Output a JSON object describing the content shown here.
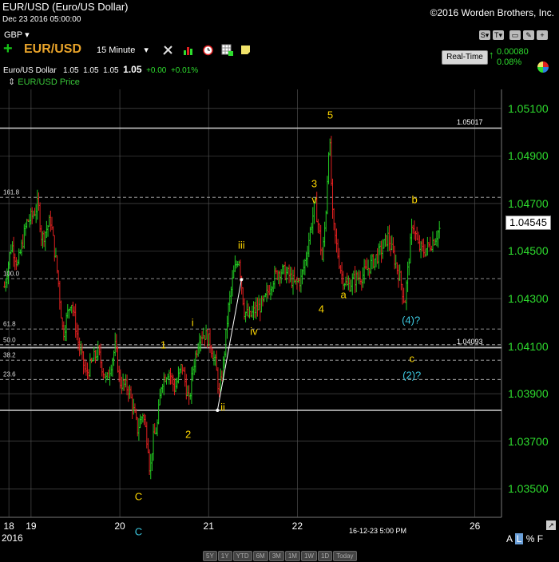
{
  "header": {
    "title": "EUR/USD (Euro/US Dollar)",
    "date": "Dec 23 2016 05:00:00",
    "copyright": "©2016 Worden Brothers, Inc.",
    "currency": "GBP ▾",
    "symbol": "EUR/USD",
    "interval": "15 Minute",
    "interval_arrow": "▾"
  },
  "quote": {
    "name": "Euro/US Dollar",
    "open": "1.05",
    "high": "1.05",
    "low": "1.05",
    "last": "1.05",
    "change": "+0.00",
    "change_pct": "+0.01%"
  },
  "legend": {
    "label": "EUR/USD Price",
    "arrow": "⇕"
  },
  "realtime": {
    "button": "Real-Time",
    "change": "0.00080",
    "change_pct": "0.08%"
  },
  "window_controls": [
    "S▾",
    "T▾",
    "▭",
    "✎",
    "+"
  ],
  "icons": [
    "tools-icon",
    "bar-chart-icon",
    "alarm-clock-icon",
    "grid-add-icon",
    "note-icon"
  ],
  "last_price_label": "1.04545",
  "bottom": {
    "year": "2016",
    "stamp": "16-12-23 5:00 PM",
    "zoom": [
      "5Y",
      "1Y",
      "YTD",
      "6M",
      "3M",
      "1M",
      "1W",
      "1D",
      "Today"
    ],
    "scale": {
      "a": "A",
      "l": "L",
      "pct": "%",
      "f": "F"
    },
    "scroll": "↗"
  },
  "chart_data": {
    "type": "line",
    "style": "ohlc-bars",
    "colors": {
      "up": "#22cc22",
      "down": "#e02020",
      "grid": "#5a5a5a",
      "axis_text": "#2edc2e"
    },
    "ylim": [
      1.0338,
      1.0518
    ],
    "yticks": [
      "1.03500",
      "1.03700",
      "1.03900",
      "1.04100",
      "1.04300",
      "1.04500",
      "1.04700",
      "1.04900",
      "1.05100"
    ],
    "xticks": [
      {
        "label": "18",
        "x": -0.15
      },
      {
        "label": "19",
        "x": 0.1
      },
      {
        "label": "20",
        "x": 1.1
      },
      {
        "label": "21",
        "x": 2.1
      },
      {
        "label": "22",
        "x": 3.1
      },
      {
        "label": "26",
        "x": 5.1
      }
    ],
    "xlim": [
      -0.25,
      5.4
    ],
    "price_path": [
      [
        -0.2,
        1.0435
      ],
      [
        -0.12,
        1.0453
      ],
      [
        -0.05,
        1.0444
      ],
      [
        0.05,
        1.0462
      ],
      [
        0.12,
        1.0465
      ],
      [
        0.18,
        1.047
      ],
      [
        0.22,
        1.0455
      ],
      [
        0.32,
        1.0463
      ],
      [
        0.4,
        1.044
      ],
      [
        0.46,
        1.0415
      ],
      [
        0.55,
        1.043
      ],
      [
        0.64,
        1.041
      ],
      [
        0.72,
        1.0398
      ],
      [
        0.85,
        1.0408
      ],
      [
        0.95,
        1.0395
      ],
      [
        1.05,
        1.041
      ],
      [
        1.1,
        1.0395
      ],
      [
        1.2,
        1.0392
      ],
      [
        1.3,
        1.0375
      ],
      [
        1.36,
        1.0382
      ],
      [
        1.42,
        1.0368
      ],
      [
        1.44,
        1.0356
      ],
      [
        1.47,
        1.037
      ],
      [
        1.52,
        1.0376
      ],
      [
        1.57,
        1.0395
      ],
      [
        1.65,
        1.04
      ],
      [
        1.72,
        1.0392
      ],
      [
        1.8,
        1.0402
      ],
      [
        1.88,
        1.0386
      ],
      [
        1.92,
        1.04
      ],
      [
        2.0,
        1.0415
      ],
      [
        2.06,
        1.0415
      ],
      [
        2.12,
        1.0411
      ],
      [
        2.18,
        1.0402
      ],
      [
        2.22,
        1.039
      ],
      [
        2.27,
        1.0404
      ],
      [
        2.32,
        1.0425
      ],
      [
        2.38,
        1.044
      ],
      [
        2.44,
        1.0448
      ],
      [
        2.5,
        1.0425
      ],
      [
        2.56,
        1.0422
      ],
      [
        2.62,
        1.0425
      ],
      [
        2.72,
        1.0428
      ],
      [
        2.82,
        1.0438
      ],
      [
        2.9,
        1.0442
      ],
      [
        3.0,
        1.044
      ],
      [
        3.07,
        1.0436
      ],
      [
        3.14,
        1.0438
      ],
      [
        3.2,
        1.0448
      ],
      [
        3.26,
        1.0462
      ],
      [
        3.3,
        1.047
      ],
      [
        3.34,
        1.046
      ],
      [
        3.38,
        1.0446
      ],
      [
        3.42,
        1.0465
      ],
      [
        3.46,
        1.05
      ],
      [
        3.5,
        1.0462
      ],
      [
        3.55,
        1.045
      ],
      [
        3.6,
        1.044
      ],
      [
        3.66,
        1.0435
      ],
      [
        3.74,
        1.0438
      ],
      [
        3.84,
        1.044
      ],
      [
        3.94,
        1.0445
      ],
      [
        4.04,
        1.045
      ],
      [
        4.12,
        1.0456
      ],
      [
        4.2,
        1.0446
      ],
      [
        4.26,
        1.0438
      ],
      [
        4.31,
        1.0428
      ],
      [
        4.36,
        1.0448
      ],
      [
        4.4,
        1.0462
      ],
      [
        4.46,
        1.0452
      ],
      [
        4.52,
        1.045
      ],
      [
        4.58,
        1.0452
      ],
      [
        4.64,
        1.0455
      ],
      [
        4.7,
        1.0459
      ]
    ],
    "horizontal_lines": [
      {
        "price": 1.05017,
        "label": "1.05017",
        "style": "solid"
      },
      {
        "price": 1.04093,
        "label": "1.04093",
        "style": "solid"
      },
      {
        "price": 1.0383,
        "label": "",
        "style": "solid"
      }
    ],
    "fib_levels": [
      {
        "label": "161.8",
        "price": 1.04726
      },
      {
        "label": "100.0",
        "price": 1.04384
      },
      {
        "label": "61.8",
        "price": 1.04172
      },
      {
        "label": "50.0",
        "price": 1.04106
      },
      {
        "label": "38.2",
        "price": 1.04041
      },
      {
        "label": "23.6",
        "price": 1.0396
      }
    ],
    "trendline": [
      [
        2.2,
        1.0383
      ],
      [
        2.47,
        1.0438
      ]
    ],
    "wave_labels": [
      {
        "text": "5",
        "x": 3.47,
        "price": 1.05072,
        "color": "yellow"
      },
      {
        "text": "3",
        "x": 3.29,
        "price": 1.04785,
        "color": "yellow"
      },
      {
        "text": "v",
        "x": 3.29,
        "price": 1.04715,
        "color": "yellow"
      },
      {
        "text": "b",
        "x": 4.42,
        "price": 1.04715,
        "color": "yellow"
      },
      {
        "text": "iii",
        "x": 2.47,
        "price": 1.04525,
        "color": "yellow"
      },
      {
        "text": "4",
        "x": 3.37,
        "price": 1.04258,
        "color": "yellow"
      },
      {
        "text": "a",
        "x": 3.62,
        "price": 1.04316,
        "color": "yellow"
      },
      {
        "text": "(4)?",
        "x": 4.38,
        "price": 1.04209,
        "color": "cyan"
      },
      {
        "text": "i",
        "x": 1.92,
        "price": 1.04199,
        "color": "yellow"
      },
      {
        "text": "1",
        "x": 1.59,
        "price": 1.04107,
        "color": "yellow"
      },
      {
        "text": "iv",
        "x": 2.61,
        "price": 1.04164,
        "color": "yellow"
      },
      {
        "text": "c",
        "x": 4.39,
        "price": 1.04049,
        "color": "yellow"
      },
      {
        "text": "(2)?",
        "x": 4.39,
        "price": 1.03979,
        "color": "cyan"
      },
      {
        "text": "ii",
        "x": 2.26,
        "price": 1.03843,
        "color": "yellow"
      },
      {
        "text": "2",
        "x": 1.87,
        "price": 1.03729,
        "color": "yellow"
      },
      {
        "text": "C",
        "x": 1.31,
        "price": 1.03466,
        "color": "yellow"
      },
      {
        "text": "C",
        "x": 1.31,
        "price": 1.0332,
        "color": "cyan"
      }
    ]
  }
}
